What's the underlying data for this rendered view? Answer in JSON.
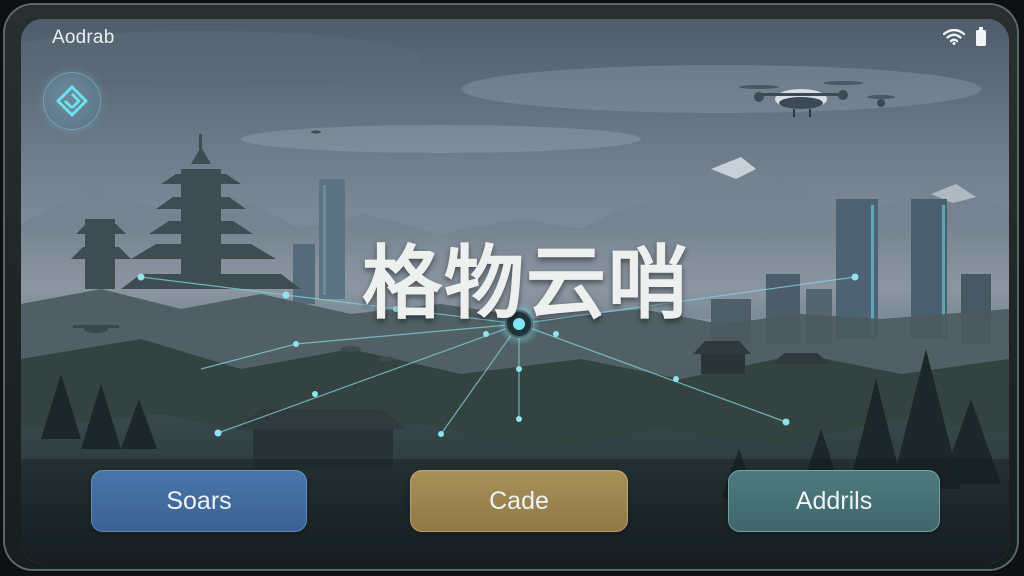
{
  "status_bar": {
    "title": "Aodrab",
    "icons": [
      "wifi-icon",
      "battery-icon"
    ]
  },
  "logo": {
    "icon": "app-logo-icon"
  },
  "hero": {
    "title": "格物云哨"
  },
  "buttons": [
    {
      "label": "Soars",
      "color": "#4470a4"
    },
    {
      "label": "Cade",
      "color": "#a08a52"
    },
    {
      "label": "Addrils",
      "color": "#48737a"
    }
  ],
  "theme": {
    "accent": "#5fd1e0",
    "sky": "#6f7f90",
    "forest": "#1d2a2c"
  }
}
